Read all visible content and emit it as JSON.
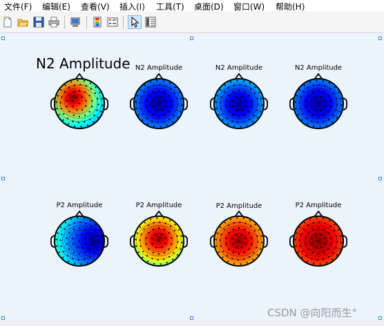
{
  "menu": [
    "文件(F)",
    "编辑(E)",
    "查看(V)",
    "插入(I)",
    "工具(T)",
    "桌面(D)",
    "窗口(W)",
    "帮助(H)"
  ],
  "toolbar": {
    "buttons": [
      {
        "name": "new-figure-button",
        "icon": "new-doc-icon"
      },
      {
        "name": "open-file-button",
        "icon": "folder-icon"
      },
      {
        "name": "save-figure-button",
        "icon": "floppy-icon"
      },
      {
        "name": "print-figure-button",
        "icon": "printer-icon"
      },
      {
        "name": "link-plot-button",
        "icon": "link-plot-icon"
      },
      {
        "name": "insert-colorbar-button",
        "icon": "colorbar-icon"
      },
      {
        "name": "insert-legend-button",
        "icon": "legend-icon"
      },
      {
        "name": "edit-plot-button",
        "icon": "cursor-arrow-icon",
        "pressed": true
      },
      {
        "name": "property-inspector-button",
        "icon": "property-panel-icon"
      }
    ]
  },
  "figure": {
    "main_title": "N2 Amplitude",
    "top_row_title": "N2 Amplitude",
    "bottom_row_title": "P2 Amplitude",
    "topomaps": [
      {
        "label": "N2 Amplitude",
        "pattern": "mixed-red-left"
      },
      {
        "label": "N2 Amplitude",
        "pattern": "deep-blue"
      },
      {
        "label": "N2 Amplitude",
        "pattern": "blue"
      },
      {
        "label": "N2 Amplitude",
        "pattern": "deep-blue"
      },
      {
        "label": "P2 Amplitude",
        "pattern": "blue-mixed"
      },
      {
        "label": "P2 Amplitude",
        "pattern": "red-center-mixed"
      },
      {
        "label": "P2 Amplitude",
        "pattern": "red-center"
      },
      {
        "label": "P2 Amplitude",
        "pattern": "red-full"
      }
    ],
    "colormap": [
      "#00008f",
      "#0000ff",
      "#0080ff",
      "#00ffff",
      "#80ff80",
      "#ffff00",
      "#ff8000",
      "#ff0000",
      "#800000"
    ]
  },
  "watermark": "CSDN @向阳而生°"
}
